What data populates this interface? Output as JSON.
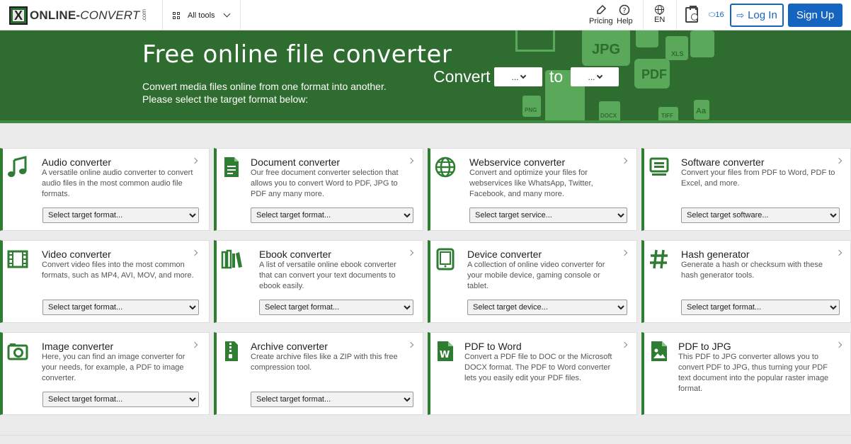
{
  "header": {
    "logo_main": "ONLINE-",
    "logo_ital": "CONVERT",
    "logo_com": ".com",
    "all_tools": "All tools",
    "pricing": "Pricing",
    "help": "Help",
    "lang": "EN",
    "credits": "⬭16",
    "login": "Log In",
    "signup": "Sign Up"
  },
  "hero": {
    "title": "Free online file converter",
    "subtitle": "Convert media files online from one format into another. Please select the target format below:",
    "convert_label": "Convert",
    "to_label": "to",
    "from_value": "...",
    "to_value": "...",
    "deco": {
      "jpg": "JPG",
      "pdf": "PDF",
      "xls": "XLS",
      "png": "PNG",
      "docx": "DOCX",
      "tiff": "TIFF",
      "aa": "Aa"
    }
  },
  "cards": [
    {
      "title": "Audio converter",
      "desc": "A versatile online audio converter to convert audio files in the most common audio file formats.",
      "select": "Select target format..."
    },
    {
      "title": "Document converter",
      "desc": "Our free document converter selection that allows you to convert Word to PDF, JPG to PDF any many more.",
      "select": "Select target format..."
    },
    {
      "title": "Webservice converter",
      "desc": "Convert and optimize your files for webservices like WhatsApp, Twitter, Facebook, and many more.",
      "select": "Select target service..."
    },
    {
      "title": "Software converter",
      "desc": "Convert your files from PDF to Word, PDF to Excel, and more.",
      "select": "Select target software..."
    },
    {
      "title": "Video converter",
      "desc": "Convert video files into the most common formats, such as MP4, AVI, MOV, and more.",
      "select": "Select target format..."
    },
    {
      "title": "Ebook converter",
      "desc": "A list of versatile online ebook converter that can convert your text documents to ebook easily.",
      "select": "Select target format..."
    },
    {
      "title": "Device converter",
      "desc": "A collection of online video converter for your mobile device, gaming console or tablet.",
      "select": "Select target device..."
    },
    {
      "title": "Hash generator",
      "desc": "Generate a hash or checksum with these hash generator tools.",
      "select": "Select target format..."
    },
    {
      "title": "Image converter",
      "desc": "Here, you can find an image converter for your needs, for example, a PDF to image converter.",
      "select": "Select target format..."
    },
    {
      "title": "Archive converter",
      "desc": "Create archive files like a ZIP with this free compression tool.",
      "select": "Select target format..."
    },
    {
      "title": "PDF to Word",
      "desc": "Convert a PDF file to DOC or the Microsoft DOCX format. The PDF to Word converter lets you easily edit your PDF files."
    },
    {
      "title": "PDF to JPG",
      "desc": "This PDF to JPG converter allows you to convert PDF to JPG, thus turning your PDF text document into the popular raster image format."
    }
  ],
  "colors": {
    "brand_green": "#2f6c2f",
    "card_accent": "#2e7d32",
    "link_blue": "#1565c0"
  }
}
